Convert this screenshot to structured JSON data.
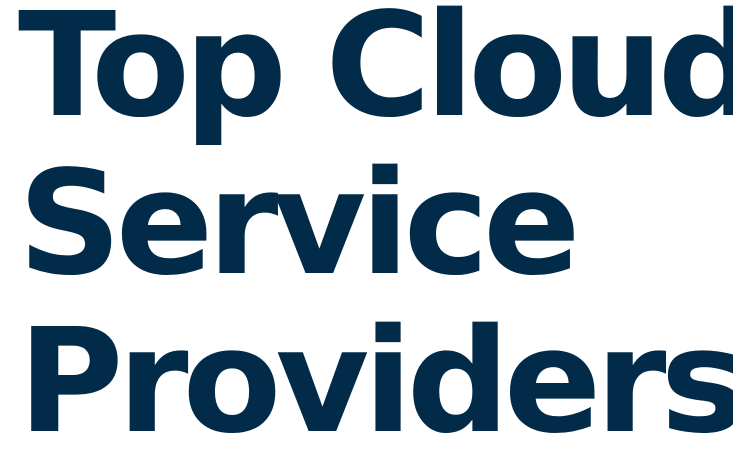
{
  "heading": {
    "line1": "Top Cloud",
    "line2": "Service",
    "line3": "Providers",
    "color": "#022b49"
  }
}
